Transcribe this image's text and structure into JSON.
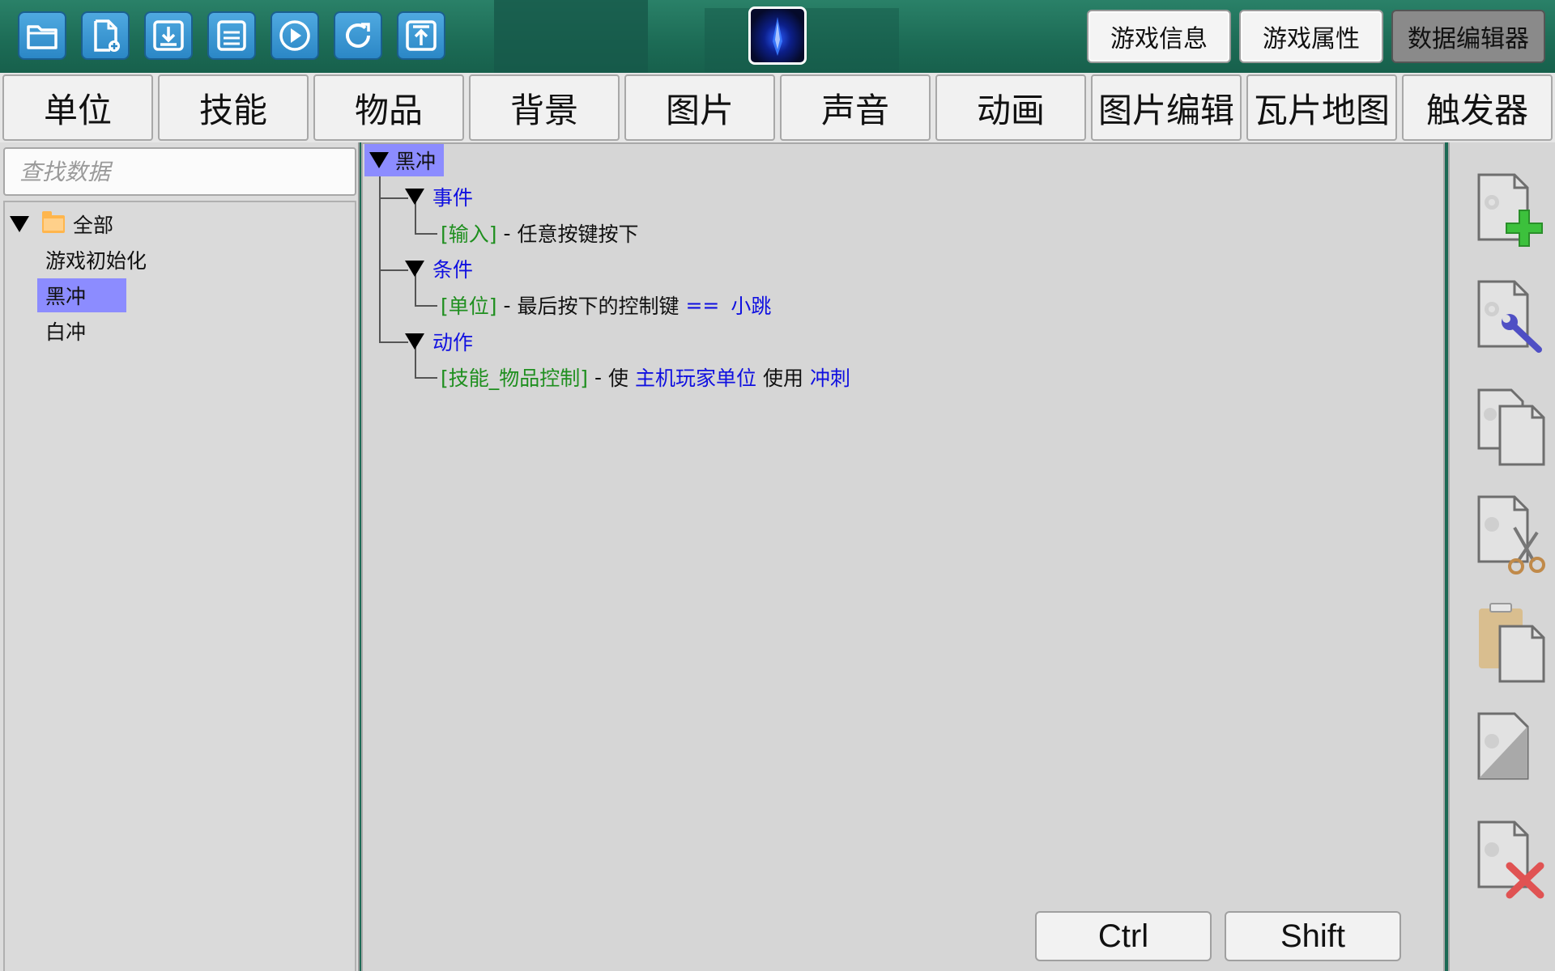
{
  "toolbar": {
    "tools": [
      {
        "name": "open-folder-icon"
      },
      {
        "name": "new-file-icon"
      },
      {
        "name": "import-icon"
      },
      {
        "name": "save-icon"
      },
      {
        "name": "play-icon"
      },
      {
        "name": "refresh-icon"
      },
      {
        "name": "upload-icon"
      }
    ],
    "game_info": "游戏信息",
    "game_props": "游戏属性",
    "data_editor": "数据编辑器"
  },
  "tabs": [
    "单位",
    "技能",
    "物品",
    "背景",
    "图片",
    "声音",
    "动画",
    "图片编辑",
    "瓦片地图",
    "触发器"
  ],
  "left": {
    "search_placeholder": "查找数据",
    "root_label": "全部",
    "items": [
      "游戏初始化",
      "黑冲",
      "白冲"
    ],
    "selected": "黑冲"
  },
  "trigger": {
    "name": "黑冲",
    "event_label": "事件",
    "event_tag": "[输入]",
    "event_sep": " - ",
    "event_text": "任意按键按下",
    "condition_label": "条件",
    "condition_tag": "[单位]",
    "condition_sep": " - ",
    "condition_text": "最后按下的控制键",
    "condition_op": "==",
    "condition_value": "小跳",
    "action_label": "动作",
    "action_tag": "[技能_物品控制]",
    "action_sep": " - ",
    "action_verb": "使",
    "action_subject": "主机玩家单位",
    "action_verb2": "使用",
    "action_object": "冲刺"
  },
  "keys": {
    "ctrl": "Ctrl",
    "shift": "Shift"
  },
  "side_tools": [
    "add-data-icon",
    "edit-data-icon",
    "copy-data-icon",
    "cut-data-icon",
    "paste-data-icon",
    "disable-data-icon",
    "delete-data-icon"
  ],
  "colors": {
    "selection": "#8c8cff",
    "accent_green": "#1f8f1f",
    "accent_blue": "#1010e0",
    "topbar": "#1c6b55"
  }
}
